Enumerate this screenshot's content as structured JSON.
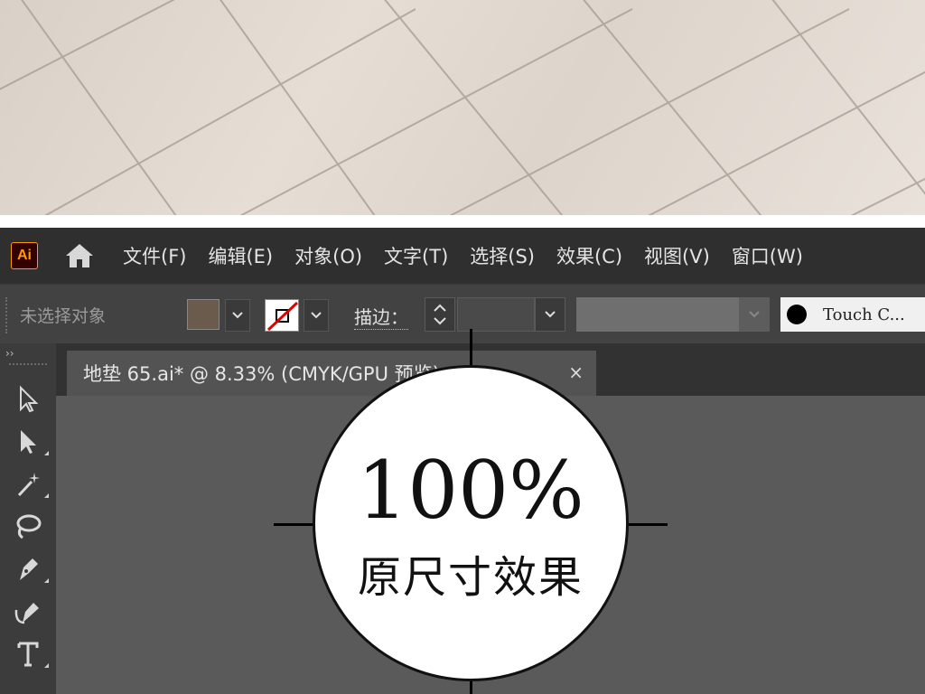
{
  "menubar": {
    "app_logo": "Ai",
    "items": [
      "文件(F)",
      "编辑(E)",
      "对象(O)",
      "文字(T)",
      "选择(S)",
      "效果(C)",
      "视图(V)",
      "窗口(W)"
    ]
  },
  "controlbar": {
    "selection_status": "未选择对象",
    "stroke_label": "描边：",
    "brush_label": "Touch C...",
    "fill_color": "#6b5b4d"
  },
  "tools_panel": {
    "collapse_label": "››",
    "tools": [
      "selection-tool-icon",
      "direct-selection-tool-icon",
      "magic-wand-tool-icon",
      "lasso-tool-icon",
      "pen-tool-icon",
      "curvature-tool-icon",
      "type-tool-icon"
    ]
  },
  "document": {
    "tab_title": "地垫 65.ai* @ 8.33% (CMYK/GPU 预览)",
    "close_label": "×"
  },
  "badge": {
    "percent": "100%",
    "caption": "原尺寸效果"
  }
}
